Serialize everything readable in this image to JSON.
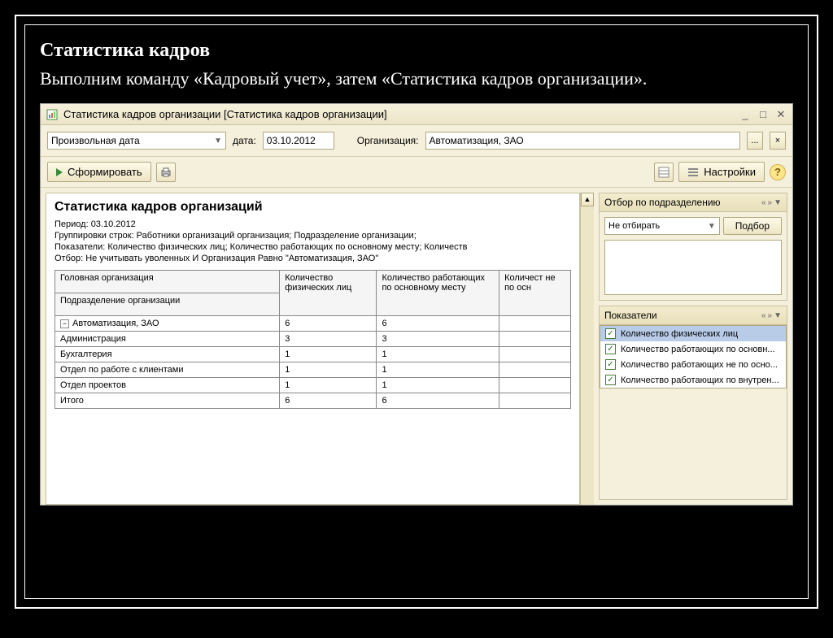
{
  "slide": {
    "title": "Статистика кадров",
    "text": "Выполним команду «Кадровый учет», затем «Статистика кадров организации»."
  },
  "window": {
    "title": "Статистика кадров организации [Статистика кадров организации]"
  },
  "params": {
    "period_mode": "Произвольная дата",
    "date_label": "дата:",
    "date_value": "03.10.2012",
    "org_label": "Организация:",
    "org_value": "Автоматизация, ЗАО",
    "ellipsis": "...",
    "clear": "×"
  },
  "toolbar": {
    "form_label": "Сформировать",
    "settings_label": "Настройки"
  },
  "report": {
    "title": "Статистика кадров организаций",
    "period_line": "Период: 03.10.2012",
    "group_line": "Группировки строк: Работники организаций организация; Подразделение организации;",
    "indic_line": "Показатели: Количество физических лиц; Количество работающих по основному месту; Количеств",
    "filter_line": "Отбор: Не учитывать уволенных И Организация Равно \"Автоматизация, ЗАО\"",
    "headers": {
      "org": "Головная организация",
      "dept": "Подразделение организации",
      "col1": "Количество физических лиц",
      "col2": "Количество работающих по основному месту",
      "col3": "Количест не по осн"
    },
    "rows": [
      {
        "name": "Автоматизация, ЗАО",
        "v1": "6",
        "v2": "6",
        "level": 0,
        "expandable": true
      },
      {
        "name": "Администрация",
        "v1": "3",
        "v2": "3",
        "level": 1
      },
      {
        "name": "Бухгалтерия",
        "v1": "1",
        "v2": "1",
        "level": 1
      },
      {
        "name": "Отдел по работе с клиентами",
        "v1": "1",
        "v2": "1",
        "level": 1
      },
      {
        "name": "Отдел проектов",
        "v1": "1",
        "v2": "1",
        "level": 1
      }
    ],
    "total": {
      "name": "Итого",
      "v1": "6",
      "v2": "6"
    }
  },
  "side": {
    "filter_title": "Отбор по подразделению",
    "filter_mode": "Не отбирать",
    "select_btn": "Подбор",
    "indic_title": "Показатели",
    "indicators": [
      "Количество физических лиц",
      "Количество работающих по основн...",
      "Количество работающих не по осно...",
      "Количество работающих по внутрен..."
    ]
  }
}
